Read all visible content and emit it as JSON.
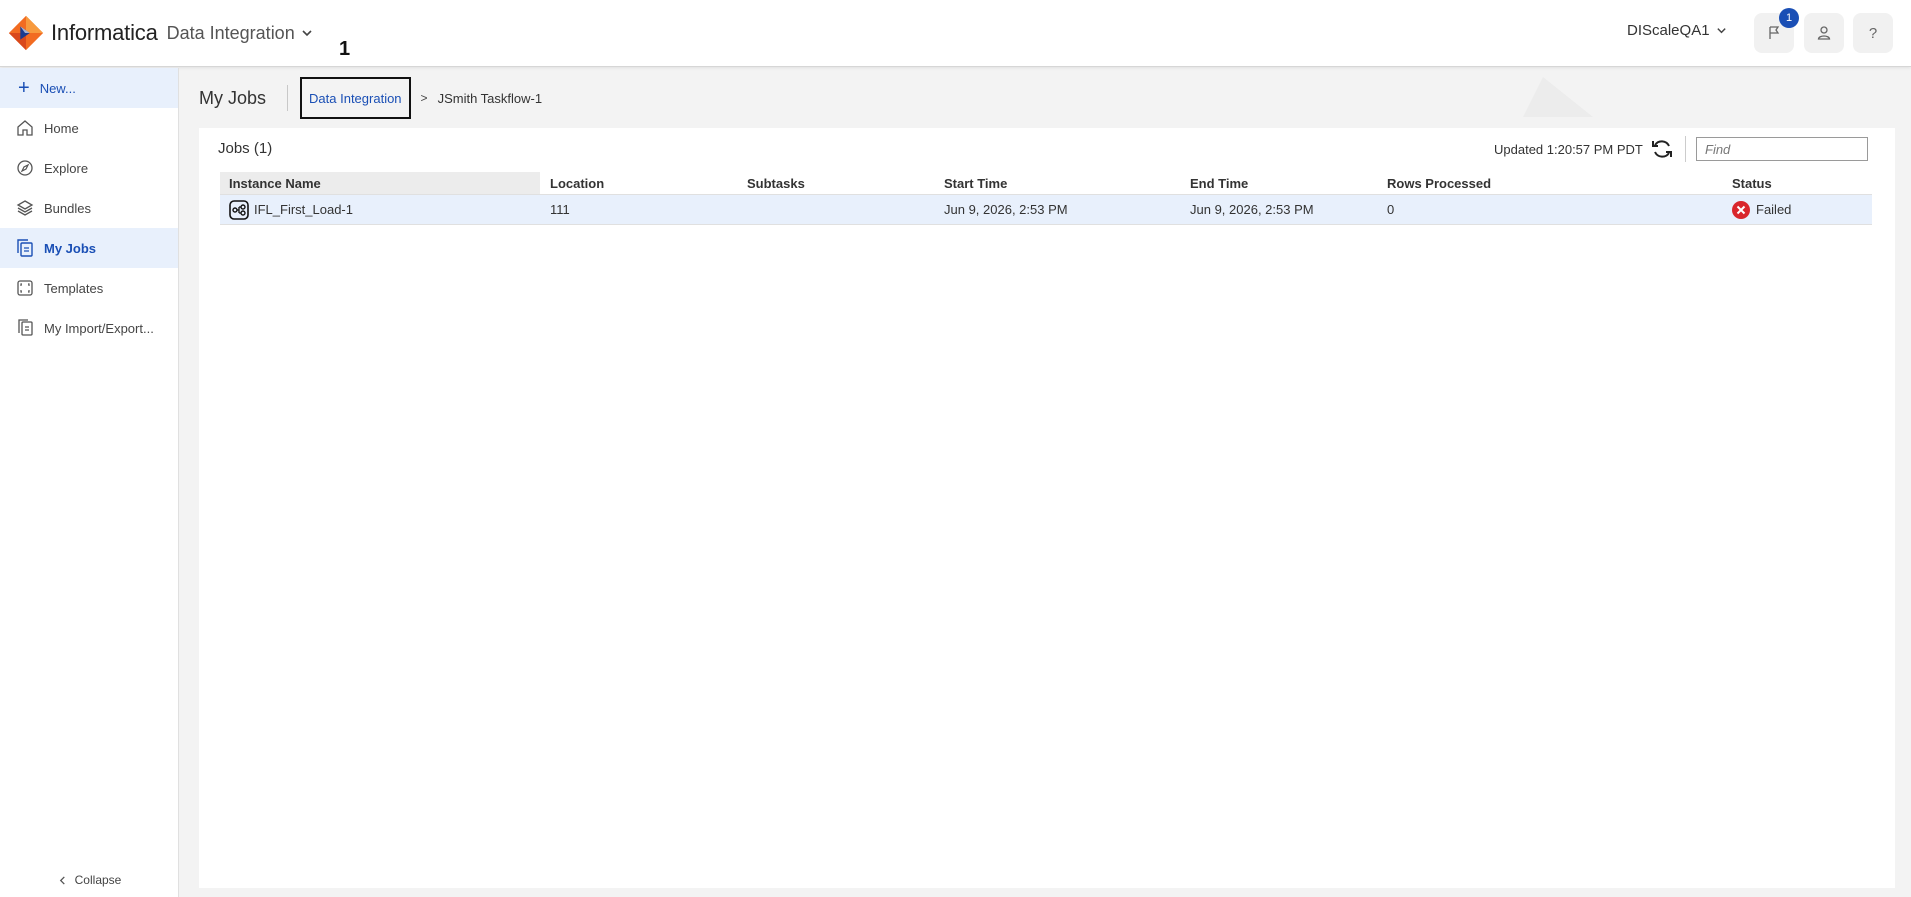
{
  "header": {
    "brand": "Informatica",
    "service": "Data Integration",
    "org": "DIScaleQA1",
    "notification_count": "1",
    "help_label": "?"
  },
  "step_marker": "1",
  "sidebar": {
    "new_label": "New...",
    "items": [
      {
        "label": "Home",
        "icon": "home-icon"
      },
      {
        "label": "Explore",
        "icon": "compass-icon"
      },
      {
        "label": "Bundles",
        "icon": "layers-icon"
      },
      {
        "label": "My Jobs",
        "icon": "jobs-icon",
        "active": true
      },
      {
        "label": "Templates",
        "icon": "templates-icon"
      },
      {
        "label": "My Import/Export...",
        "icon": "import-export-icon"
      }
    ],
    "collapse_label": "Collapse"
  },
  "page": {
    "title": "My Jobs",
    "breadcrumb_link": "Data Integration",
    "breadcrumb_sep": ">",
    "breadcrumb_current": "JSmith Taskflow-1"
  },
  "jobs": {
    "title": "Jobs (1)",
    "updated": "Updated 1:20:57 PM PDT",
    "find_placeholder": "Find",
    "columns": [
      "Instance Name",
      "Location",
      "Subtasks",
      "Start Time",
      "End Time",
      "Rows Processed",
      "Status"
    ],
    "rows": [
      {
        "instance_name": "IFL_First_Load-1",
        "location": "111",
        "subtasks": "",
        "start_time": "Jun 9, 2026, 2:53 PM",
        "end_time": "Jun 9, 2026, 2:53 PM",
        "rows_processed": "0",
        "status": "Failed"
      }
    ]
  },
  "colors": {
    "accent": "#1a4fb5",
    "selected_bg": "#e8f0fc",
    "failed": "#d9262c"
  }
}
